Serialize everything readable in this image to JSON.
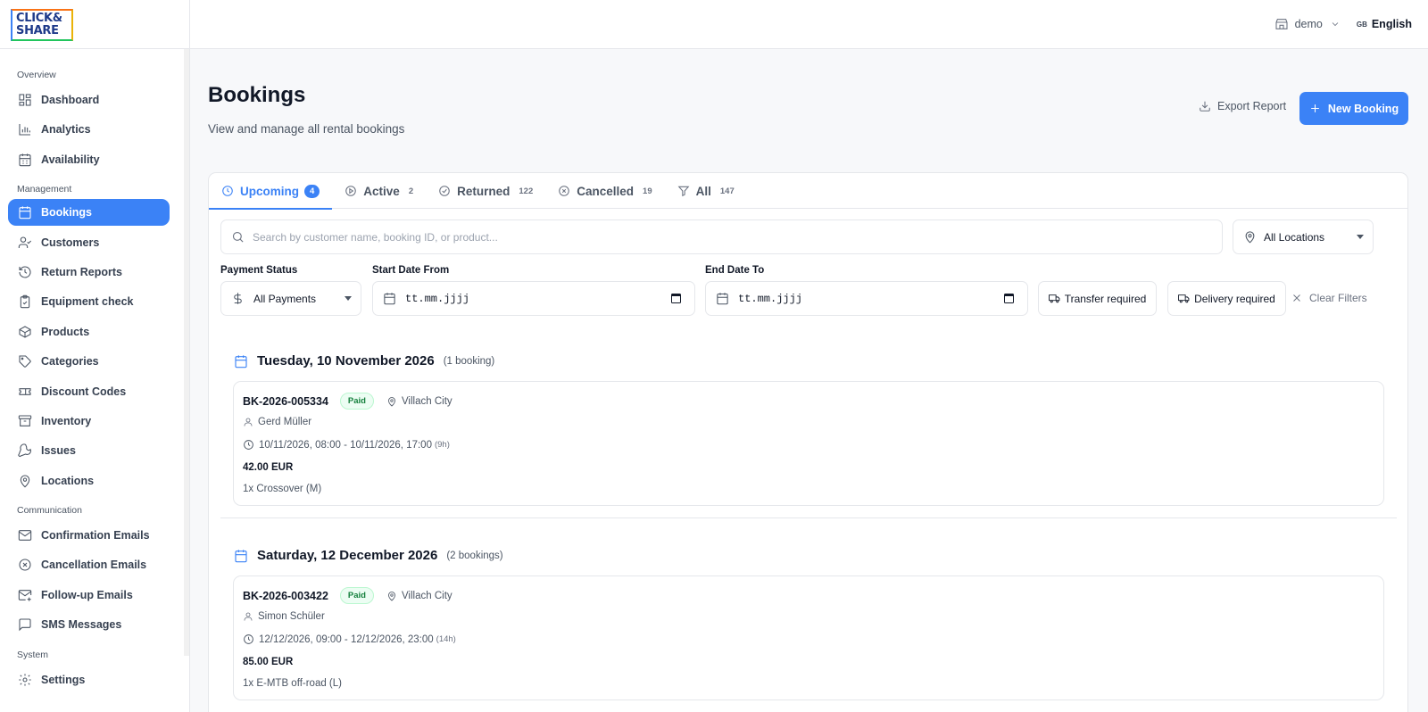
{
  "logo": {
    "line1": "CLICK&",
    "line2": "SHARE"
  },
  "sidebar": {
    "sections": [
      {
        "title": "Overview",
        "items": [
          {
            "label": "Dashboard",
            "icon": "dashboard-icon"
          },
          {
            "label": "Analytics",
            "icon": "bar-chart-icon"
          },
          {
            "label": "Availability",
            "icon": "calendar-check-icon"
          }
        ]
      },
      {
        "title": "Management",
        "items": [
          {
            "label": "Bookings",
            "icon": "calendar-icon",
            "active": true
          },
          {
            "label": "Customers",
            "icon": "user-check-icon"
          },
          {
            "label": "Return Reports",
            "icon": "history-icon"
          },
          {
            "label": "Equipment check",
            "icon": "clipboard-check-icon"
          },
          {
            "label": "Products",
            "icon": "package-icon"
          },
          {
            "label": "Categories",
            "icon": "tag-icon"
          },
          {
            "label": "Discount Codes",
            "icon": "ticket-icon"
          },
          {
            "label": "Inventory",
            "icon": "archive-icon"
          },
          {
            "label": "Issues",
            "icon": "wrench-icon"
          },
          {
            "label": "Locations",
            "icon": "map-pin-icon"
          }
        ]
      },
      {
        "title": "Communication",
        "items": [
          {
            "label": "Confirmation Emails",
            "icon": "mail-icon"
          },
          {
            "label": "Cancellation Emails",
            "icon": "x-circle-icon"
          },
          {
            "label": "Follow-up Emails",
            "icon": "mail-plus-icon"
          },
          {
            "label": "SMS Messages",
            "icon": "message-square-icon"
          }
        ]
      },
      {
        "title": "System",
        "items": [
          {
            "label": "Settings",
            "icon": "gear-icon"
          }
        ]
      }
    ]
  },
  "topbar": {
    "store": "demo",
    "lang_flag": "GB",
    "lang": "English"
  },
  "header": {
    "title": "Bookings",
    "subtitle": "View and manage all rental bookings",
    "export_label": "Export Report",
    "new_label": "New Booking"
  },
  "tabs": [
    {
      "label": "Upcoming",
      "count": "4",
      "active": true
    },
    {
      "label": "Active",
      "count": "2"
    },
    {
      "label": "Returned",
      "count": "122"
    },
    {
      "label": "Cancelled",
      "count": "19"
    },
    {
      "label": "All",
      "count": "147"
    }
  ],
  "filters": {
    "search_placeholder": "Search by customer name, booking ID, or product...",
    "location": "All Locations",
    "payment_label": "Payment Status",
    "payment_value": "All Payments",
    "start_label": "Start Date From",
    "start_value": "tt.mm.jjjj",
    "end_label": "End Date To",
    "end_value": "tt.mm.jjjj",
    "transfer": "Transfer required",
    "delivery": "Delivery required",
    "clear": "Clear Filters"
  },
  "groups": [
    {
      "date": "Tuesday, 10 November 2026",
      "count": "(1 booking)",
      "bookings": [
        {
          "id": "BK-2026-005334",
          "status": "Paid",
          "location": "Villach City",
          "customer": "Gerd Müller",
          "time": "10/11/2026, 08:00 - 10/11/2026, 17:00",
          "duration": "(9h)",
          "price": "42.00 EUR",
          "items": "1x Crossover (M)"
        }
      ]
    },
    {
      "date": "Saturday, 12 December 2026",
      "count": "(2 bookings)",
      "bookings": [
        {
          "id": "BK-2026-003422",
          "status": "Paid",
          "location": "Villach City",
          "customer": "Simon Schüler",
          "time": "12/12/2026, 09:00 - 12/12/2026, 23:00",
          "duration": "(14h)",
          "price": "85.00 EUR",
          "items": "1x E-MTB off-road (L)"
        }
      ]
    }
  ]
}
